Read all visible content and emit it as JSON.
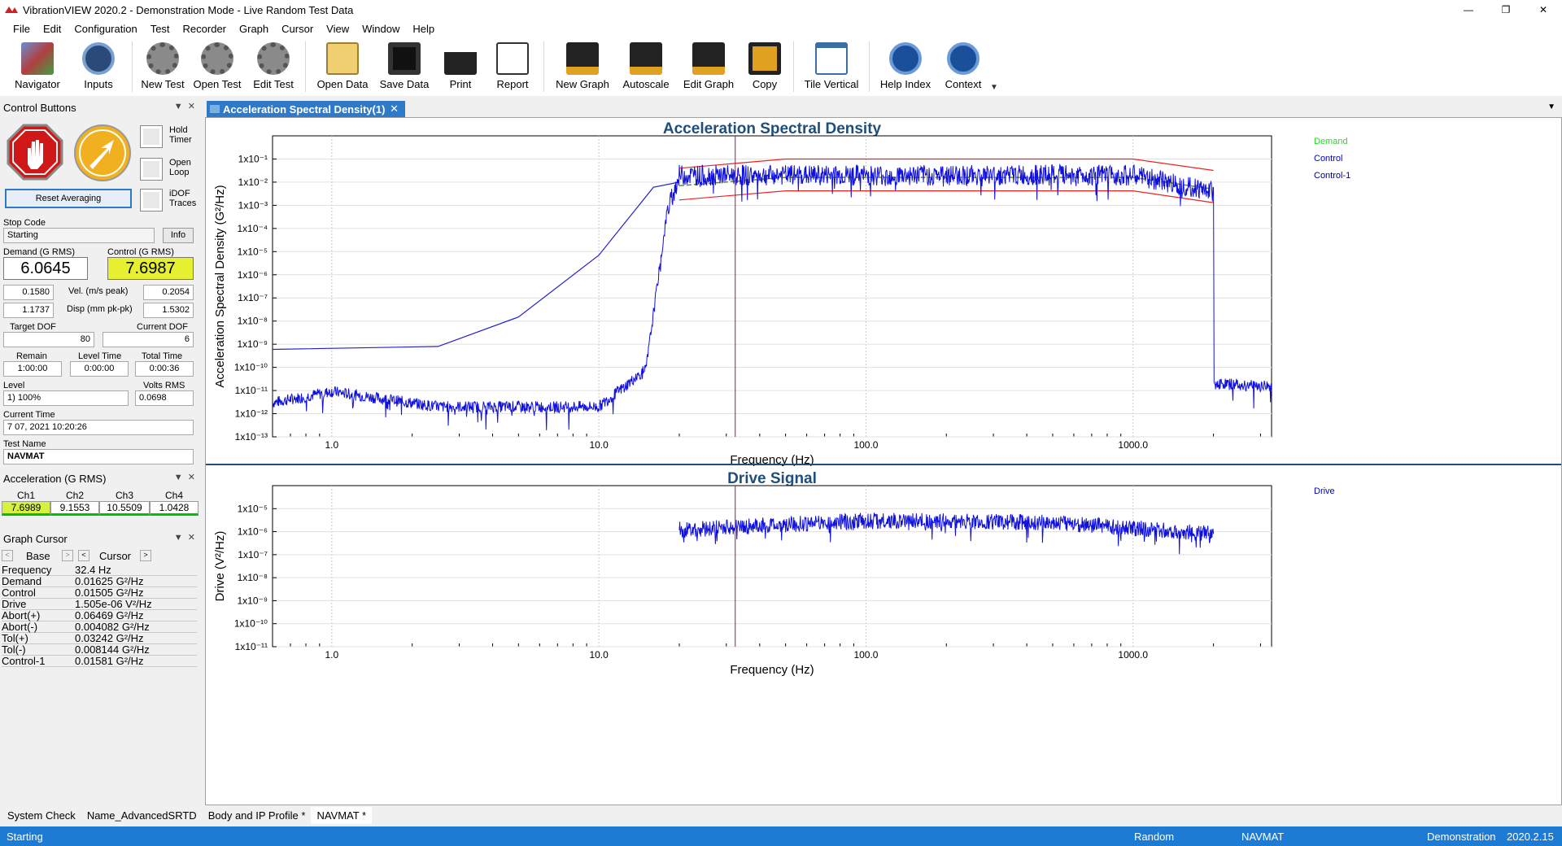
{
  "window": {
    "title": "VibrationVIEW 2020.2 - Demonstration Mode - Live Random Test Data"
  },
  "menu": [
    "File",
    "Edit",
    "Configuration",
    "Test",
    "Recorder",
    "Graph",
    "Cursor",
    "View",
    "Window",
    "Help"
  ],
  "toolbar": {
    "navigator": "Navigator",
    "inputs": "Inputs",
    "new_test": "New Test",
    "open_test": "Open Test",
    "edit_test": "Edit Test",
    "open_data": "Open Data",
    "save_data": "Save Data",
    "print": "Print",
    "report": "Report",
    "new_graph": "New Graph",
    "autoscale": "Autoscale",
    "edit_graph": "Edit Graph",
    "copy": "Copy",
    "tile_vertical": "Tile Vertical",
    "help_index": "Help Index",
    "context": "Context"
  },
  "control_panel": {
    "header": "Control Buttons",
    "hold_timer": "Hold Timer",
    "open_loop": "Open Loop",
    "idof_traces": "iDOF Traces",
    "reset_averaging": "Reset Averaging",
    "stop_code_label": "Stop Code",
    "stop_code_value": "Starting",
    "info_button": "Info",
    "demand_label": "Demand (G RMS)",
    "demand_value": "6.0645",
    "control_label": "Control (G RMS)",
    "control_value": "7.6987",
    "vel_label": "Vel. (m/s peak)",
    "vel_demand": "0.1580",
    "vel_control": "0.2054",
    "disp_label": "Disp (mm pk-pk)",
    "disp_demand": "1.1737",
    "disp_control": "1.5302",
    "target_dof_label": "Target DOF",
    "target_dof_value": "80",
    "current_dof_label": "Current DOF",
    "current_dof_value": "6",
    "remain_label": "Remain",
    "remain_value": "1:00:00",
    "level_time_label": "Level Time",
    "level_time_value": "0:00:00",
    "total_time_label": "Total Time",
    "total_time_value": "0:00:36",
    "level_label": "Level",
    "level_value": "1) 100%",
    "volts_rms_label": "Volts RMS",
    "volts_rms_value": "0.0698",
    "current_time_label": "Current Time",
    "current_time_value": "7 07, 2021 10:20:26",
    "test_name_label": "Test Name",
    "test_name_value": "NAVMAT"
  },
  "accel_panel": {
    "header": "Acceleration (G RMS)",
    "channels": [
      {
        "name": "Ch1",
        "value": "7.6989",
        "color": "#d8f040"
      },
      {
        "name": "Ch2",
        "value": "9.1553",
        "color": "#ffffff"
      },
      {
        "name": "Ch3",
        "value": "10.5509",
        "color": "#ffffff"
      },
      {
        "name": "Ch4",
        "value": "1.0428",
        "color": "#ffffff"
      }
    ]
  },
  "cursor_panel": {
    "header": "Graph Cursor",
    "base_label": "Base",
    "cursor_label": "Cursor",
    "rows": [
      {
        "name": "Frequency",
        "value": "32.4  Hz"
      },
      {
        "name": "Demand",
        "value": "0.01625  G²/Hz"
      },
      {
        "name": "Control",
        "value": "0.01505  G²/Hz"
      },
      {
        "name": "Drive",
        "value": "1.505e-06  V²/Hz"
      },
      {
        "name": "Abort(+)",
        "value": "0.06469  G²/Hz"
      },
      {
        "name": "Abort(-)",
        "value": "0.004082  G²/Hz"
      },
      {
        "name": "Tol(+)",
        "value": "0.03242  G²/Hz"
      },
      {
        "name": "Tol(-)",
        "value": "0.008144  G²/Hz"
      },
      {
        "name": "Control-1",
        "value": "0.01581  G²/Hz"
      }
    ]
  },
  "graph_tab": {
    "label": "Acceleration Spectral Density(1)"
  },
  "chart_data": [
    {
      "type": "line",
      "title": "Acceleration Spectral Density",
      "xlabel": "Frequency (Hz)",
      "ylabel": "Acceleration Spectral Density (G²/Hz)",
      "xscale": "log",
      "yscale": "log",
      "xlim": [
        0.6,
        3300
      ],
      "ylim": [
        1e-13,
        1
      ],
      "x_ticks": [
        "1.0",
        "10.0",
        "100.0",
        "1000.0"
      ],
      "y_ticks": [
        "1x10⁻¹",
        "1x10⁻²",
        "1x10⁻³",
        "1x10⁻⁴",
        "1x10⁻⁵",
        "1x10⁻⁶",
        "1x10⁻⁷",
        "1x10⁻⁸",
        "1x10⁻⁹",
        "1x10⁻¹⁰",
        "1x10⁻¹¹",
        "1x10⁻¹²",
        "1x10⁻¹³"
      ],
      "legend": [
        "Demand",
        "Control",
        "Control-1"
      ],
      "legend_colors": [
        "#22dd22",
        "#0000cc",
        "#000080"
      ],
      "cursor_x": 32.4,
      "series": [
        {
          "name": "Demand",
          "x": [
            20,
            50,
            1000,
            2000
          ],
          "y": [
            0.007,
            0.016,
            0.016,
            0.005
          ]
        },
        {
          "name": "Abort(+)",
          "x": [
            20,
            50,
            1000,
            2000
          ],
          "y": [
            0.04,
            0.1,
            0.1,
            0.032
          ]
        },
        {
          "name": "Abort(-)",
          "x": [
            20,
            50,
            1000,
            2000
          ],
          "y": [
            0.0017,
            0.0042,
            0.0042,
            0.0013
          ]
        },
        {
          "name": "Control-1",
          "x": [
            0.6,
            2.5,
            5,
            10,
            16,
            20
          ],
          "y": [
            6e-10,
            8e-10,
            1.5e-08,
            7e-06,
            0.006,
            0.01
          ]
        },
        {
          "name": "Control",
          "x": [
            0.6,
            1,
            2.5,
            10,
            15,
            18,
            20,
            50,
            1000,
            2000,
            2010,
            3300
          ],
          "y": [
            3e-12,
            9e-12,
            2e-12,
            2e-12,
            8e-11,
            0.0005,
            0.02,
            0.02,
            0.02,
            0.004,
            2e-11,
            1.5e-11
          ]
        }
      ]
    },
    {
      "type": "line",
      "title": "Drive Signal",
      "xlabel": "Frequency (Hz)",
      "ylabel": "Drive (V²/Hz)",
      "xscale": "log",
      "yscale": "log",
      "xlim": [
        0.6,
        3300
      ],
      "ylim": [
        1e-11,
        0.0001
      ],
      "x_ticks": [
        "1.0",
        "10.0",
        "100.0",
        "1000.0"
      ],
      "y_ticks": [
        "1x10⁻⁵",
        "1x10⁻⁶",
        "1x10⁻⁷",
        "1x10⁻⁸",
        "1x10⁻⁹",
        "1x10⁻¹⁰",
        "1x10⁻¹¹"
      ],
      "legend": [
        "Drive"
      ],
      "legend_colors": [
        "#0000cc"
      ],
      "cursor_x": 32.4,
      "series": [
        {
          "name": "Drive",
          "x": [
            20,
            40,
            100,
            500,
            2000
          ],
          "y": [
            1.2e-06,
            1.8e-06,
            3e-06,
            2.5e-06,
            8e-07
          ]
        }
      ]
    }
  ],
  "bottom_tabs": [
    "System Check",
    "Name_AdvancedSRTD",
    "Body and IP Profile *",
    "NAVMAT *"
  ],
  "status": {
    "left": "Starting",
    "mode": "Random",
    "test": "NAVMAT",
    "demo": "Demonstration",
    "version": "2020.2.15"
  }
}
